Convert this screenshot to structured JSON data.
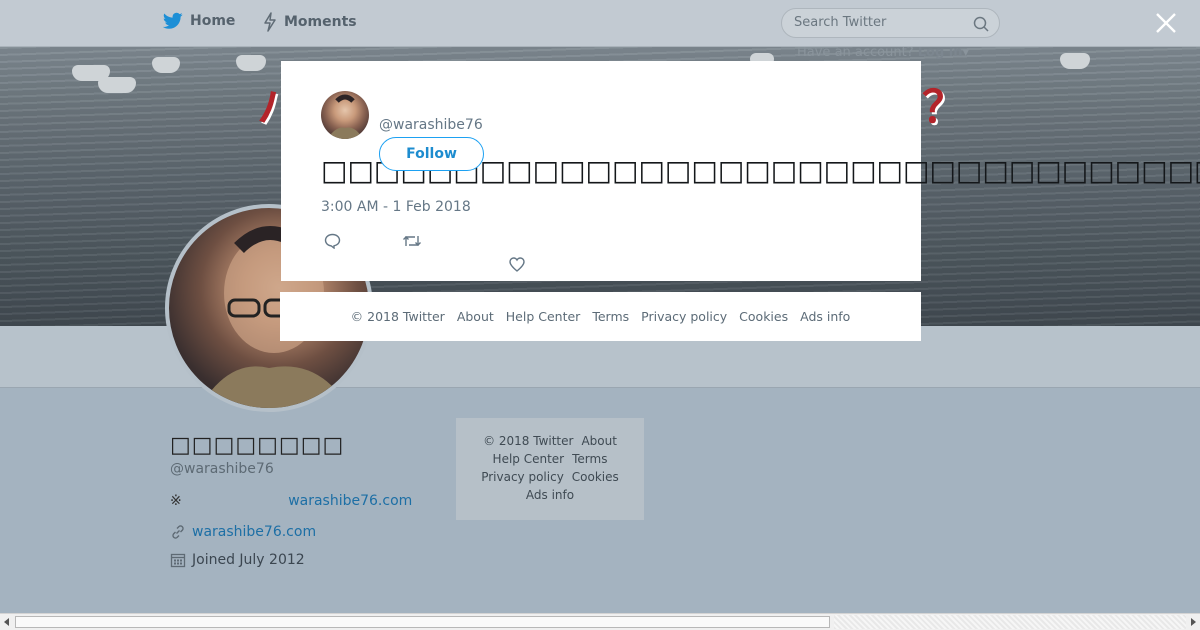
{
  "nav": {
    "home_label": "Home",
    "moments_label": "Moments",
    "search_placeholder": "Search Twitter",
    "login_prompt": "Have an account?",
    "login_label": "Log in"
  },
  "banner": {
    "text_left": "ハ",
    "text_right": "？"
  },
  "profile": {
    "display_name": "□□□□□□□□",
    "handle": "@warashibe76",
    "bio_prefix": "※",
    "bio_link": "warashibe76.com",
    "website": "warashibe76.com",
    "joined": "Joined July 2012"
  },
  "side_footer": {
    "links": [
      "© 2018 Twitter",
      "About",
      "Help Center",
      "Terms",
      "Privacy policy",
      "Cookies",
      "Ads info"
    ]
  },
  "tweet": {
    "handle": "@warashibe76",
    "follow_label": "Follow",
    "text": "□□□□□□□□□□□□□□□□□□□□□□□□□□□□□□□□□□□□□□□□□□□□",
    "timestamp": "3:00 AM - 1 Feb 2018",
    "icons": [
      "reply-icon",
      "retweet-icon",
      "like-icon"
    ]
  },
  "modal_footer": {
    "links": [
      "© 2018 Twitter",
      "About",
      "Help Center",
      "Terms",
      "Privacy policy",
      "Cookies",
      "Ads info"
    ]
  },
  "colors": {
    "twitter_blue": "#1da1f2",
    "link_blue": "#1d6fa5",
    "overlay_gray": "#a4b3c0"
  }
}
